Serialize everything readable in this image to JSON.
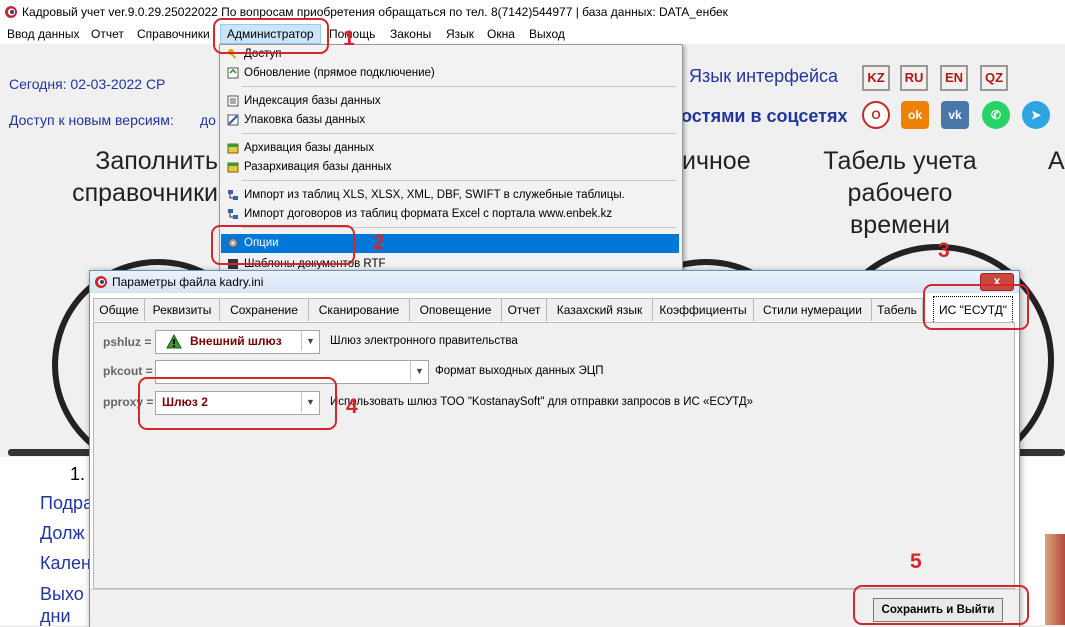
{
  "window": {
    "title": "Кадровый учет ver.9.0.29.25022022 По вопросам приобретения обращаться по тел. 8(7142)544977 | база данных: DATA_енбек"
  },
  "menubar": {
    "items": [
      "Ввод данных",
      "Отчет",
      "Справочники",
      "Администратор",
      "Помощь",
      "Законы",
      "Язык",
      "Окна",
      "Выход"
    ]
  },
  "background": {
    "today": "Сегодня: 02-03-2022 СР",
    "new_versions": "Доступ к новым версиям:",
    "new_versions_tail": "до",
    "lang_label": "Язык интерфейса",
    "lang_buttons": [
      "KZ",
      "RU",
      "EN",
      "QZ"
    ],
    "social_label": "остями в соцсетях",
    "tile_fill_1": "Заполнить",
    "tile_fill_2": "справочники",
    "tile_mid": "ичное",
    "tile_tabel_1": "Табель учета",
    "tile_tabel_2": "рабочего",
    "tile_tabel_3": "времени",
    "tile_right": "А",
    "list_number": "1.",
    "list_items": [
      "Подра",
      "Долж",
      "Кален",
      "Выхо",
      "дни"
    ]
  },
  "admin_menu": {
    "items": [
      "Доступ",
      "Обновление (прямое подключение)",
      "Индексация базы данных",
      "Упаковка базы данных",
      "Архивация базы данных",
      "Разархивация базы данных",
      "Импорт из таблиц XLS, XLSX, XML, DBF, SWIFT в служебные таблицы.",
      "Импорт договоров из таблиц формата Excel с портала www.enbek.kz",
      "Опции",
      "Шаблоны документов RTF"
    ]
  },
  "dialog": {
    "title": "Параметры файла kadry.ini",
    "close": "x",
    "tabs": [
      "Общие",
      "Реквизиты",
      "Сохранение",
      "Сканирование",
      "Оповещение",
      "Отчет",
      "Казахский язык",
      "Коэффициенты",
      "Стили нумерации",
      "Табель",
      "ИС \"ЕСУТД\""
    ],
    "active_tab": "ИС \"ЕСУТД\"",
    "fields": [
      {
        "label": "pshluz =",
        "value": "Внешний шлюз",
        "description": "Шлюз электронного правительства"
      },
      {
        "label": "pkcout =",
        "value": "",
        "description": "Формат выходных данных ЭЦП"
      },
      {
        "label": "pproxy =",
        "value": "Шлюз 2",
        "description": "Использовать шлюз ТОО \"KostanaySoft\" для отправки запросов в ИС «ЕСУТД»"
      }
    ],
    "save_button": "Сохранить и Выйти"
  },
  "annotations": [
    "1",
    "2",
    "3",
    "4",
    "5"
  ],
  "colors": {
    "annotation": "#d3272d",
    "selection": "#0078d7",
    "link_blue": "#2035a0"
  }
}
